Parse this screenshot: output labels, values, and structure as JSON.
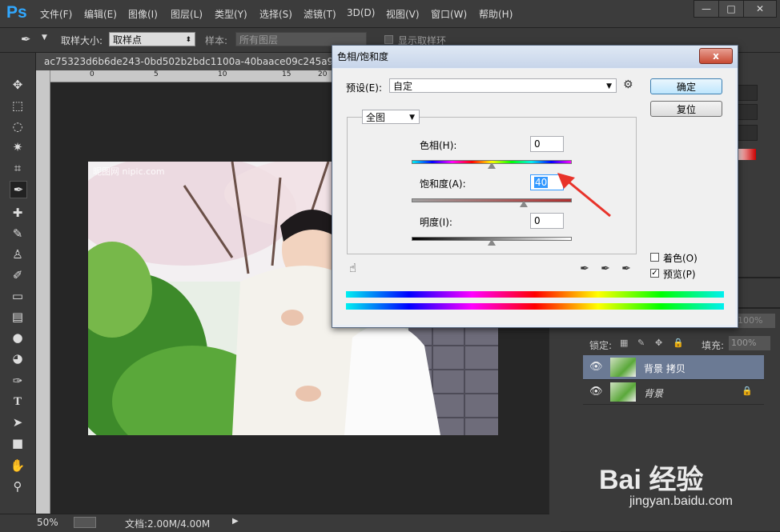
{
  "app": {
    "logo": "Ps"
  },
  "menu": [
    "文件(F)",
    "编辑(E)",
    "图像(I)",
    "图层(L)",
    "类型(Y)",
    "选择(S)",
    "滤镜(T)",
    "3D(D)",
    "视图(V)",
    "窗口(W)",
    "帮助(H)"
  ],
  "window_buttons": {
    "minimize": "—",
    "maximize": "□",
    "close": "✕"
  },
  "options": {
    "sample_size_label": "取样大小:",
    "sample_size_value": "取样点",
    "sample_label": "样本:",
    "sample_value": "所有图层",
    "show_ring_label": "显示取样环"
  },
  "document": {
    "tab_title": "ac75323d6b6de243-0bd502b2bdc1100a-40baace09c245a9b55d4",
    "ruler_labels": [
      "0",
      "5",
      "10",
      "15",
      "20"
    ],
    "watermark": "昵图网 nipic.com"
  },
  "status": {
    "zoom": "50%",
    "doc_info": "文档:2.00M/4.00M"
  },
  "dialog": {
    "title": "色相/饱和度",
    "close": "x",
    "preset_label": "预设(E):",
    "preset_value": "自定",
    "ok": "确定",
    "reset": "复位",
    "channel": "全图",
    "hue_label": "色相(H):",
    "hue_value": "0",
    "saturation_label": "饱和度(A):",
    "saturation_value": "40",
    "lightness_label": "明度(I):",
    "lightness_value": "0",
    "colorize_label": "着色(O)",
    "preview_label": "预览(P)",
    "preview_checked": "✓"
  },
  "sliders": {
    "hue": 0.5,
    "saturation": 0.7,
    "lightness": 0.5
  },
  "layers": {
    "lock_label": "锁定:",
    "fill_label": "填充:",
    "fill_value": "100%",
    "opacity_value": "100%",
    "items": [
      {
        "name": "背景 拷贝",
        "selected": true
      },
      {
        "name": "背景",
        "selected": false
      }
    ]
  },
  "watermark_brand": {
    "main": "Bai 经验",
    "url": "jingyan.baidu.com"
  }
}
